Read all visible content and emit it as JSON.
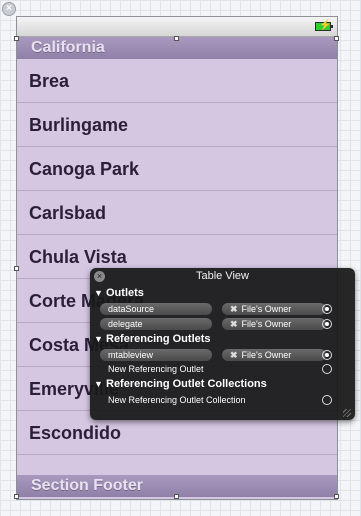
{
  "table": {
    "section_header": "California",
    "rows": [
      "Brea",
      "Burlingame",
      "Canoga Park",
      "Carlsbad",
      "Chula Vista",
      "Corte Madera",
      "Costa Mesa",
      "Emeryville",
      "Escondido"
    ],
    "section_footer": "Section Footer"
  },
  "status": {
    "battery_icon": "battery-charging-icon"
  },
  "hud": {
    "title": "Table View",
    "sections": {
      "outlets": "Outlets",
      "referencing_outlets": "Referencing Outlets",
      "referencing_collections": "Referencing Outlet Collections"
    },
    "outlets": [
      {
        "name": "dataSource",
        "target": "File's Owner"
      },
      {
        "name": "delegate",
        "target": "File's Owner"
      }
    ],
    "referencing": [
      {
        "name": "mtableview",
        "target": "File's Owner"
      }
    ],
    "new_referencing_outlet": "New Referencing Outlet",
    "new_referencing_collection": "New Referencing Outlet Collection",
    "x_glyph": "✖",
    "close_glyph": "×",
    "triangle_glyph": "▼"
  }
}
